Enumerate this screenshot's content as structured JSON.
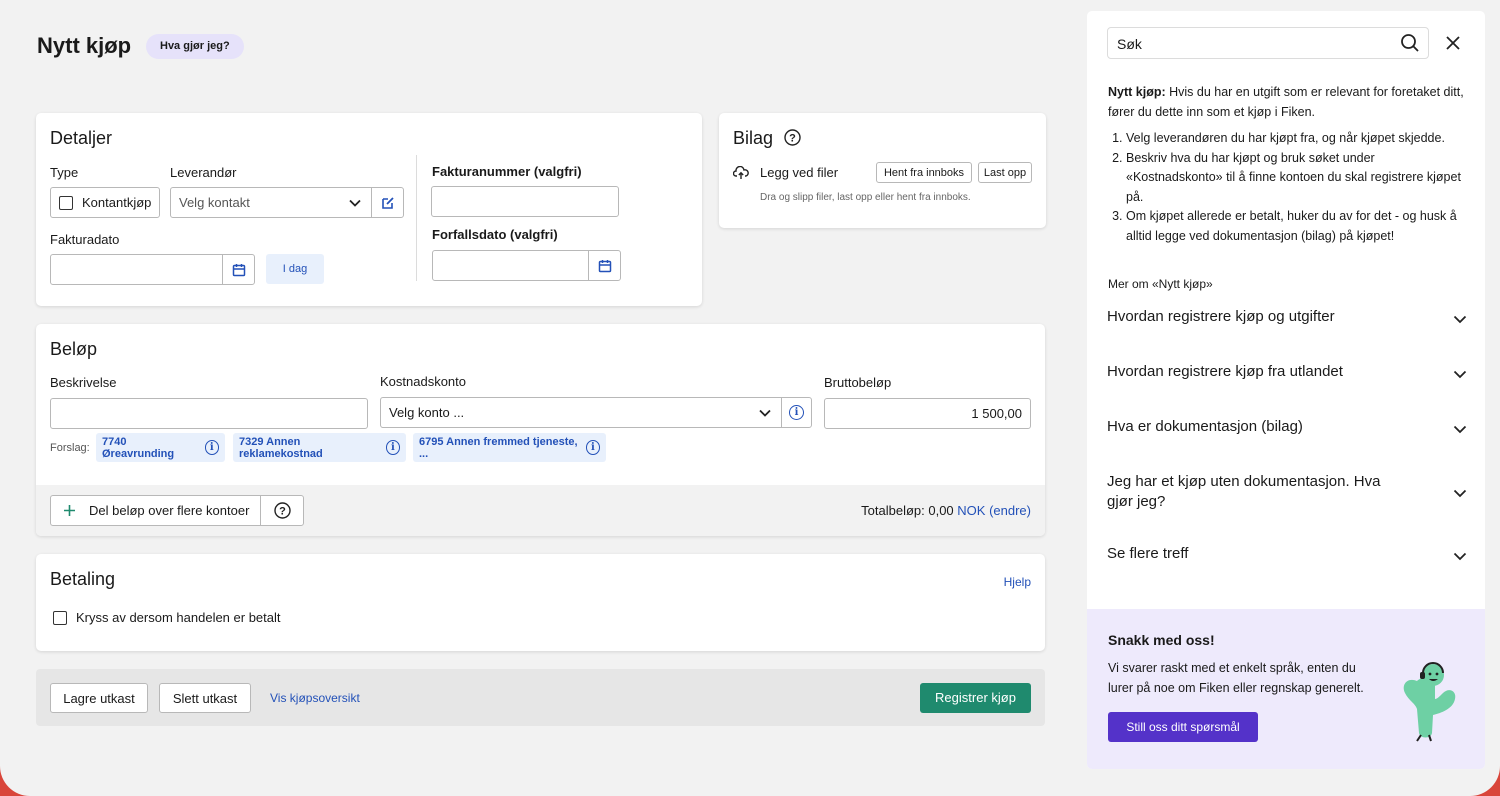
{
  "page": {
    "title": "Nytt kjøp",
    "help_pill": "Hva gjør jeg?"
  },
  "detaljer": {
    "heading": "Detaljer",
    "type_label": "Type",
    "kontantkjop_label": "Kontantkjøp",
    "leverandor_label": "Leverandør",
    "leverandor_placeholder": "Velg kontakt",
    "fakturadato_label": "Fakturadato",
    "idag_label": "I dag",
    "fakturanummer_label": "Fakturanummer (valgfri)",
    "forfallsdato_label": "Forfallsdato (valgfri)"
  },
  "bilag": {
    "heading": "Bilag",
    "legg_ved": "Legg ved filer",
    "hent_fra_innboks": "Hent fra innboks",
    "last_opp": "Last opp",
    "hint": "Dra og slipp filer, last opp eller hent fra innboks."
  },
  "belop": {
    "heading": "Beløp",
    "beskrivelse_label": "Beskrivelse",
    "kostnadskonto_label": "Kostnadskonto",
    "kostnadskonto_placeholder": "Velg konto ...",
    "bruttobelop_label": "Bruttobeløp",
    "bruttobelop_value": "1 500,00",
    "forslag_label": "Forslag:",
    "suggestions": [
      {
        "label": "7740 Øreavrunding"
      },
      {
        "label": "7329 Annen reklamekostnad"
      },
      {
        "label": "6795 Annen fremmed tjeneste, ..."
      }
    ],
    "del_belop": "Del beløp over flere kontoer",
    "totalbelop_prefix": "Totalbeløp: 0,00",
    "totalbelop_link": "NOK (endre)"
  },
  "betaling": {
    "heading": "Betaling",
    "hjelp": "Hjelp",
    "checkbox_label": "Kryss av dersom handelen er betalt"
  },
  "footer": {
    "lagre": "Lagre utkast",
    "slett": "Slett utkast",
    "vis": "Vis kjøpsoversikt",
    "registrer": "Registrer kjøp"
  },
  "sidebar": {
    "search_placeholder": "Søk",
    "intro_bold": "Nytt kjøp:",
    "intro_text": " Hvis du har en utgift som er relevant for foretaket ditt, fører du dette inn som et kjøp i Fiken.",
    "steps": [
      "Velg leverandøren du har kjøpt fra, og når kjøpet skjedde.",
      "Beskriv hva du har kjøpt og bruk søket under «Kostnadskonto» til å finne kontoen du skal registrere kjøpet på.",
      "Om kjøpet allerede er betalt, huker du av for det - og husk å alltid legge ved dokumentasjon (bilag) på kjøpet!"
    ],
    "more_label": "Mer om «Nytt kjøp»",
    "accordion": [
      "Hvordan registrere kjøp og utgifter",
      "Hvordan registrere kjøp fra utlandet",
      "Hva er dokumentasjon (bilag)",
      "Jeg har et kjøp uten dokumentasjon. Hva gjør jeg?",
      "Se flere treff"
    ],
    "chat": {
      "title": "Snakk med oss!",
      "text": "Vi svarer raskt med et enkelt språk, enten du lurer på noe om Fiken eller regnskap generelt.",
      "button": "Still oss ditt spørsmål"
    }
  },
  "colors": {
    "accent_blue": "#2351b8",
    "primary_green": "#1f8a6e",
    "purple_button": "#5432c9",
    "chat_bg": "#eeeafc",
    "frame_border": "#d9453a"
  }
}
